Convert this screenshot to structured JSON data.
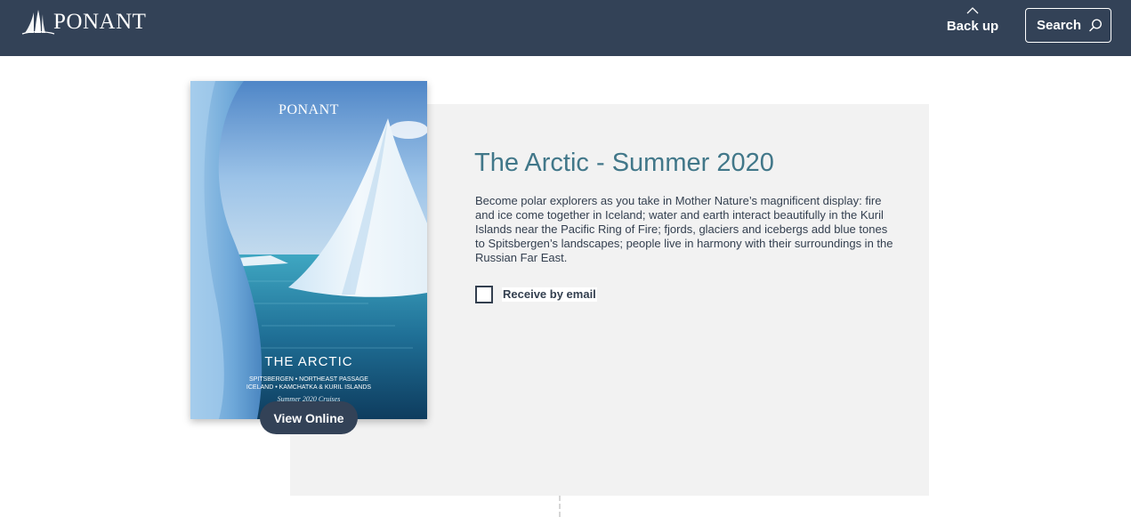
{
  "header": {
    "logo_text": "PONANT",
    "backup_label": "Back up",
    "search_label": "Search"
  },
  "brochure": {
    "cover": {
      "logo_text": "PONANT",
      "title": "THE ARCTIC",
      "subtitle_line1": "SPITSBERGEN • NORTHEAST PASSAGE",
      "subtitle_line2": "ICELAND • KAMCHATKA & KURIL ISLANDS",
      "subtitle_line3": "Summer 2020 Cruises"
    },
    "view_online_label": "View Online",
    "title": "The Arctic - Summer 2020",
    "description": "Become polar explorers as you take in Mother Nature’s magnificent display: fire and ice come together in Iceland; water and earth interact beautifully in the Kuril Islands near the Pacific Ring of Fire; fjords, glaciers and icebergs add blue tones to Spitsbergen’s landscapes; people live in harmony with their surroundings in the Russian Far East.",
    "receive_by_email_label": "Receive by email",
    "receive_by_email_checked": false
  },
  "colors": {
    "header_bg": "#334257",
    "title_color": "#417789",
    "panel_bg": "#f2f2f2",
    "text_color": "#333f4f"
  },
  "icons": {
    "logo": "sailboat-logo-icon",
    "backup": "chevron-up-icon",
    "search": "search-icon"
  }
}
